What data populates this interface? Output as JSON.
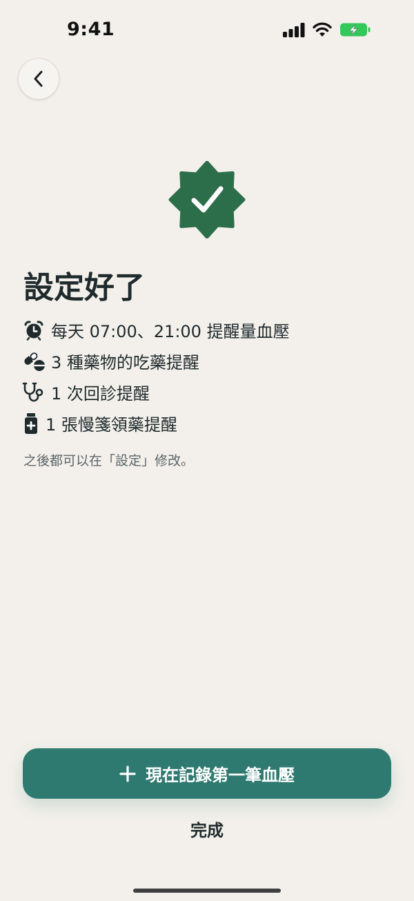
{
  "status_bar": {
    "time": "9:41",
    "icons": [
      "cellular-icon",
      "wifi-icon",
      "battery-charging-icon"
    ],
    "battery_color": "#34c759"
  },
  "nav": {
    "back_icon": "chevron-left-icon"
  },
  "badge": {
    "icon": "check-badge-icon",
    "color": "#2d6e4a"
  },
  "title": "設定好了",
  "items": [
    {
      "icon": "alarm-clock-icon",
      "text": "每天 07:00、21:00 提醒量血壓"
    },
    {
      "icon": "pills-icon",
      "text": "3 種藥物的吃藥提醒"
    },
    {
      "icon": "stethoscope-icon",
      "text": "1 次回診提醒"
    },
    {
      "icon": "medicine-bottle-icon",
      "text": "1 張慢箋領藥提醒"
    }
  ],
  "hint": "之後都可以在「設定」修改。",
  "primary_button": {
    "icon": "plus-icon",
    "label": "現在記錄第一筆血壓",
    "color": "#2f7a70"
  },
  "secondary_button": {
    "label": "完成"
  }
}
